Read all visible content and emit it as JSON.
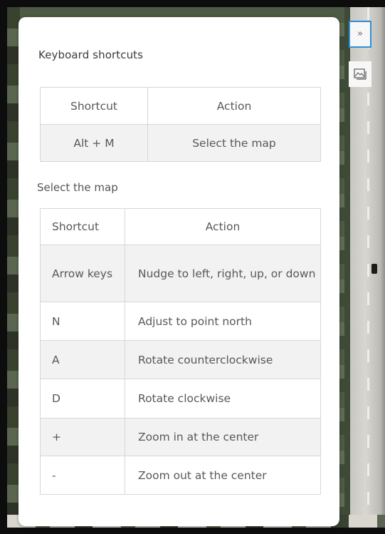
{
  "panel": {
    "title": "Keyboard shortcuts"
  },
  "general_table": {
    "headers": [
      "Shortcut",
      "Action"
    ],
    "rows": [
      {
        "shortcut": "Alt + M",
        "action": "Select the map"
      }
    ]
  },
  "section": {
    "title": "Select the map"
  },
  "map_table": {
    "headers": [
      "Shortcut",
      "Action"
    ],
    "rows": [
      {
        "shortcut": "Arrow keys",
        "action": "Nudge to left, right, up, or down"
      },
      {
        "shortcut": "N",
        "action": "Adjust to point north"
      },
      {
        "shortcut": "A",
        "action": "Rotate counterclockwise"
      },
      {
        "shortcut": "D",
        "action": "Rotate clockwise"
      },
      {
        "shortcut": "+",
        "action": "Zoom in at the center"
      },
      {
        "shortcut": "-",
        "action": "Zoom out at the center"
      }
    ]
  },
  "controls": {
    "expand_label": "»",
    "expand_icon": "double-chevron-right-icon",
    "basemap_icon": "basemap-gallery-icon"
  },
  "colors": {
    "accent": "#2d8ed8",
    "alt_row": "#f2f2f2"
  }
}
